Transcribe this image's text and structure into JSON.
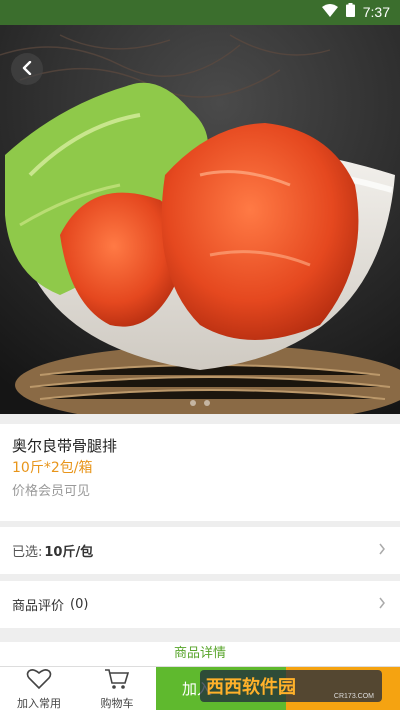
{
  "status_bar": {
    "time": "7:37"
  },
  "product": {
    "name": "奥尔良带骨腿排",
    "spec": "10斤*2包/箱",
    "price_note": "价格会员可见",
    "image_dots": 2
  },
  "selection": {
    "label": "已选:",
    "value": "10斤/包"
  },
  "reviews": {
    "label": "商品评价",
    "count": "(0)"
  },
  "detail_tab": {
    "label": "商品详情"
  },
  "bottom_bar": {
    "favorite_label": "加入常用",
    "cart_label": "购物车",
    "add_to_cart_label": "加入"
  },
  "watermark": {
    "text": "西西软件园",
    "url": "CR173.COM"
  },
  "colors": {
    "status_bar": "#3b6e2d",
    "accent_green": "#5fb92e",
    "accent_orange": "#f5a311",
    "spec_orange": "#e8951a"
  }
}
